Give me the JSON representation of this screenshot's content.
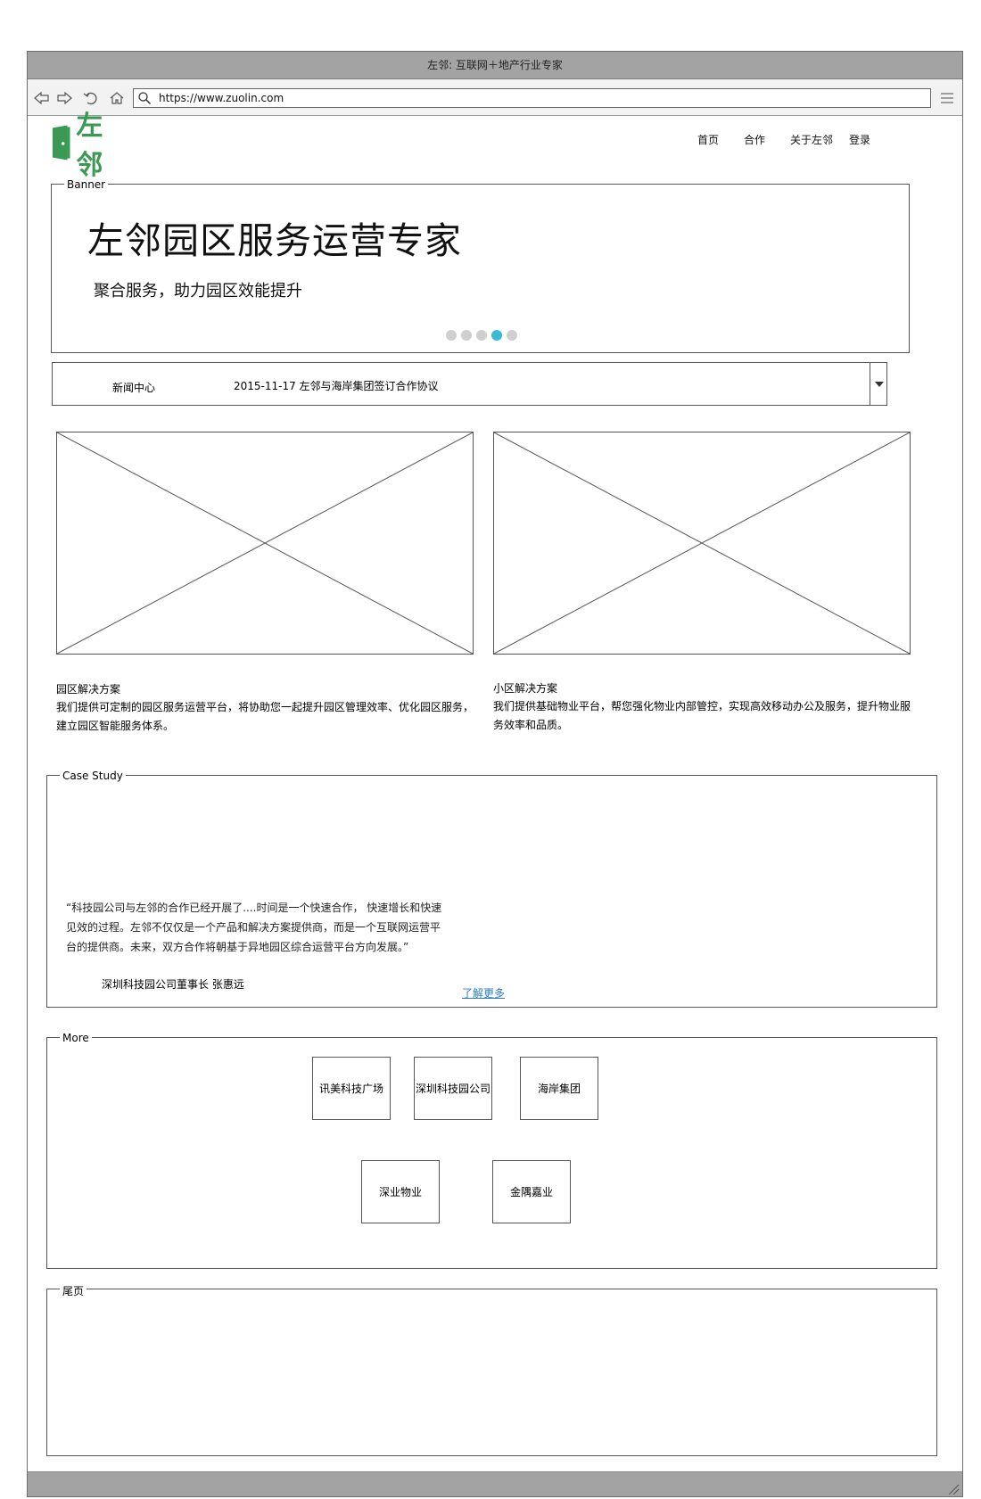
{
  "window": {
    "title": "左邻: 互联网＋地产行业专家",
    "url": "https://www.zuolin.com"
  },
  "header": {
    "logo_text": "左邻",
    "nav": [
      "首页",
      "合作",
      "关于左邻",
      "登录"
    ]
  },
  "banner": {
    "legend": "Banner",
    "title": "左邻园区服务运营专家",
    "subtitle": "聚合服务，助力园区效能提升",
    "dots_total": 5,
    "active_dot_index": 3
  },
  "news": {
    "label": "新闻中心",
    "item": "2015-11-17 左邻与海岸集团签订合作协议"
  },
  "solutions": [
    {
      "title": "园区解决方案",
      "desc": "我们提供可定制的园区服务运营平台，将协助您一起提升园区管理效率、优化园区服务，建立园区智能服务体系。"
    },
    {
      "title": "小区解决方案",
      "desc": "我们提供基础物业平台，帮您强化物业内部管控，实现高效移动办公及服务，提升物业服务效率和品质。"
    }
  ],
  "case_study": {
    "legend": "Case Study",
    "quote": "“科技园公司与左邻的合作已经开展了....时间是一个快速合作， 快速增长和快速见效的过程。左邻不仅仅是一个产品和解决方案提供商，而是一个互联网运营平台的提供商。未来，双方合作将朝基于异地园区综合运营平台方向发展。”",
    "author": "深圳科技园公司董事长 张惠远",
    "link": "了解更多"
  },
  "more": {
    "legend": "More",
    "partners": [
      "讯美科技广场",
      "深圳科技园公司",
      "海岸集团",
      "深业物业",
      "金隅嘉业"
    ]
  },
  "footer": {
    "legend": "尾页"
  },
  "colors": {
    "brand_green": "#3a9a54",
    "dot_active": "#3bbad6",
    "link": "#2a7fc7",
    "chrome_gray": "#a3a3a3"
  }
}
